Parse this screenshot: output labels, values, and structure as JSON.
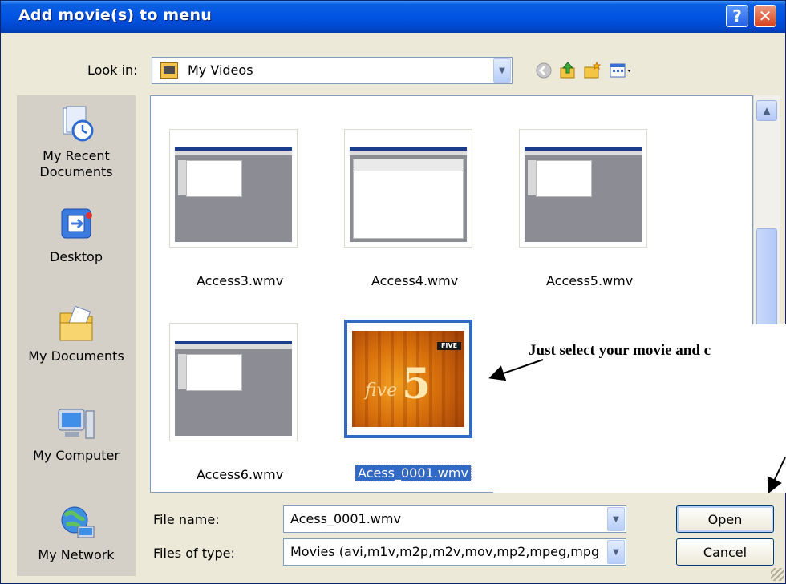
{
  "window": {
    "title": "Add movie(s) to menu",
    "help_glyph": "?",
    "close_glyph": "✕"
  },
  "look_in": {
    "label": "Look in:",
    "value": "My Videos"
  },
  "toolbar_icons": [
    "back-icon",
    "up-folder-icon",
    "new-folder-icon",
    "view-menu-icon"
  ],
  "places": [
    {
      "label_line1": "My Recent",
      "label_line2": "Documents"
    },
    {
      "label_line1": "Desktop",
      "label_line2": ""
    },
    {
      "label_line1": "My Documents",
      "label_line2": ""
    },
    {
      "label_line1": "My Computer",
      "label_line2": ""
    },
    {
      "label_line1": "My Network",
      "label_line2": ""
    }
  ],
  "files": [
    {
      "name": "Access3.wmv"
    },
    {
      "name": "Access4.wmv"
    },
    {
      "name": "Access5.wmv"
    },
    {
      "name": "Access6.wmv"
    },
    {
      "name": "Acess_0001.wmv",
      "selected": true
    }
  ],
  "movie_thumbnail": {
    "word": "five",
    "digit": "5",
    "badge": "FIVE"
  },
  "annotation": "Just select your movie and c",
  "file_name": {
    "label": "File name:",
    "value": "Acess_0001.wmv"
  },
  "file_type": {
    "label": "Files of type:",
    "value": "Movies (avi,m1v,m2p,m2v,mov,mp2,mpeg,mpg"
  },
  "buttons": {
    "open": "Open",
    "cancel": "Cancel"
  },
  "colors": {
    "titlebar": "#0054e3",
    "selection": "#316ac5",
    "dialog_bg": "#ece9d8"
  }
}
